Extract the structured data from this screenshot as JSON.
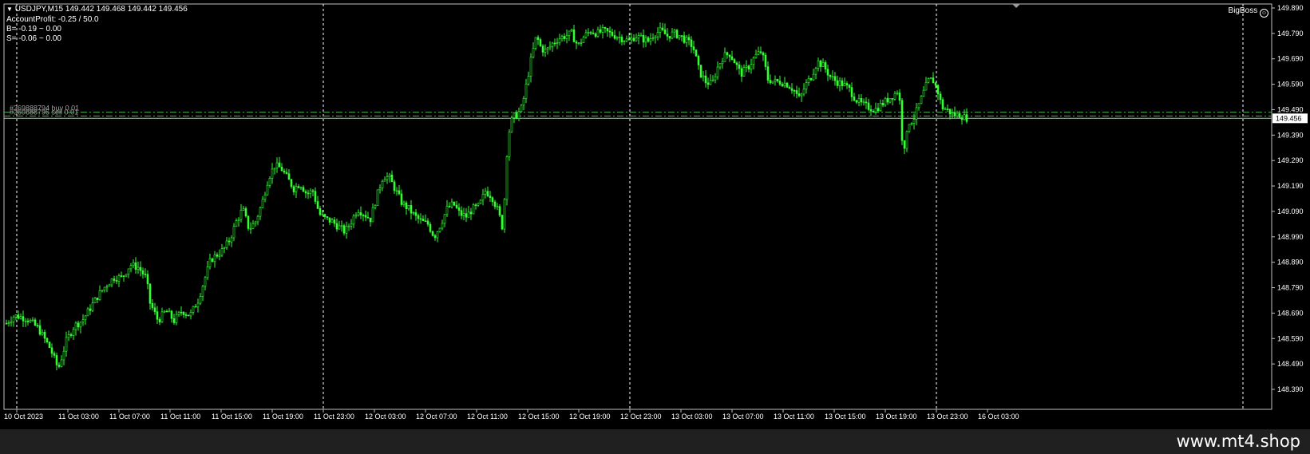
{
  "header": {
    "symbol_line": "USDJPY,M15  149.442 149.468 149.442 149.456",
    "account_profit": "AccountProfit:  -0.25 / 50.0",
    "b_line": "B= -0.19 ~ 0.00",
    "s_line": "S= -0.06 ~ 0.00",
    "brand": "BigBoss"
  },
  "footer": {
    "website": "www.mt4.shop"
  },
  "colors": {
    "background": "#000000",
    "candles": "#33ff33",
    "price_line": "#a8c8a8",
    "grid": "#ffffff"
  },
  "icons": {
    "collapse": "triangle-down-icon",
    "smiley": "smiley-icon"
  },
  "chart_data": {
    "type": "candlestick",
    "symbol": "USDJPY",
    "timeframe": "M15",
    "ohlc": {
      "open": 149.442,
      "high": 149.468,
      "low": 149.442,
      "close": 149.456
    },
    "ylim": [
      148.39,
      149.89
    ],
    "y_ticks": [
      "149.890",
      "149.790",
      "149.690",
      "149.590",
      "149.490",
      "149.390",
      "149.290",
      "149.190",
      "149.090",
      "148.990",
      "148.890",
      "148.790",
      "148.690",
      "148.590",
      "148.490",
      "148.390"
    ],
    "current_price": "149.456",
    "x_ticks": [
      "10 Oct 2023",
      "11 Oct 03:00",
      "11 Oct 07:00",
      "11 Oct 11:00",
      "11 Oct 15:00",
      "11 Oct 19:00",
      "11 Oct 23:00",
      "12 Oct 03:00",
      "12 Oct 07:00",
      "12 Oct 11:00",
      "12 Oct 15:00",
      "12 Oct 19:00",
      "12 Oct 23:00",
      "13 Oct 03:00",
      "13 Oct 07:00",
      "13 Oct 11:00",
      "13 Oct 15:00",
      "13 Oct 19:00",
      "13 Oct 23:00",
      "16 Oct 03:00"
    ],
    "orders": [
      {
        "label": "#369888794 buy 0.01",
        "price": 149.48
      },
      {
        "label": "#369888795 sell 0.01",
        "price": 149.465
      }
    ],
    "close_path": [
      [
        0,
        148.65
      ],
      [
        10,
        148.68
      ],
      [
        25,
        148.67
      ],
      [
        40,
        148.63
      ],
      [
        55,
        148.55
      ],
      [
        65,
        148.47
      ],
      [
        75,
        148.58
      ],
      [
        85,
        148.64
      ],
      [
        95,
        148.66
      ],
      [
        105,
        148.71
      ],
      [
        115,
        148.76
      ],
      [
        125,
        148.8
      ],
      [
        135,
        148.83
      ],
      [
        145,
        148.83
      ],
      [
        155,
        148.88
      ],
      [
        165,
        148.87
      ],
      [
        175,
        148.83
      ],
      [
        180,
        148.73
      ],
      [
        190,
        148.66
      ],
      [
        200,
        148.7
      ],
      [
        210,
        148.66
      ],
      [
        220,
        148.7
      ],
      [
        230,
        148.68
      ],
      [
        240,
        148.74
      ],
      [
        248,
        148.82
      ],
      [
        256,
        148.9
      ],
      [
        264,
        148.92
      ],
      [
        272,
        148.94
      ],
      [
        280,
        148.98
      ],
      [
        288,
        149.05
      ],
      [
        296,
        149.1
      ],
      [
        304,
        149.02
      ],
      [
        312,
        149.05
      ],
      [
        320,
        149.12
      ],
      [
        328,
        149.22
      ],
      [
        336,
        149.27
      ],
      [
        344,
        149.26
      ],
      [
        352,
        149.22
      ],
      [
        360,
        149.18
      ],
      [
        368,
        149.2
      ],
      [
        376,
        149.16
      ],
      [
        384,
        149.17
      ],
      [
        392,
        149.08
      ],
      [
        400,
        149.06
      ],
      [
        408,
        149.05
      ],
      [
        416,
        149.03
      ],
      [
        424,
        149.01
      ],
      [
        432,
        149.05
      ],
      [
        440,
        149.1
      ],
      [
        448,
        149.08
      ],
      [
        456,
        149.06
      ],
      [
        464,
        149.15
      ],
      [
        472,
        149.23
      ],
      [
        480,
        149.22
      ],
      [
        488,
        149.17
      ],
      [
        496,
        149.12
      ],
      [
        504,
        149.1
      ],
      [
        512,
        149.07
      ],
      [
        520,
        149.05
      ],
      [
        528,
        149.04
      ],
      [
        536,
        148.99
      ],
      [
        544,
        149.04
      ],
      [
        552,
        149.1
      ],
      [
        560,
        149.12
      ],
      [
        568,
        149.08
      ],
      [
        576,
        149.07
      ],
      [
        584,
        149.1
      ],
      [
        592,
        149.11
      ],
      [
        600,
        149.17
      ],
      [
        608,
        149.15
      ],
      [
        616,
        149.09
      ],
      [
        622,
        149.02
      ],
      [
        628,
        149.38
      ],
      [
        634,
        149.46
      ],
      [
        640,
        149.47
      ],
      [
        646,
        149.5
      ],
      [
        652,
        149.6
      ],
      [
        658,
        149.7
      ],
      [
        664,
        149.78
      ],
      [
        670,
        149.73
      ],
      [
        676,
        149.72
      ],
      [
        684,
        149.75
      ],
      [
        692,
        149.77
      ],
      [
        700,
        149.78
      ],
      [
        708,
        149.79
      ],
      [
        716,
        149.74
      ],
      [
        724,
        149.78
      ],
      [
        732,
        149.8
      ],
      [
        740,
        149.79
      ],
      [
        748,
        149.8
      ],
      [
        756,
        149.79
      ],
      [
        764,
        149.78
      ],
      [
        772,
        149.77
      ],
      [
        780,
        149.76
      ],
      [
        788,
        149.78
      ],
      [
        796,
        149.77
      ],
      [
        804,
        149.76
      ],
      [
        812,
        149.79
      ],
      [
        820,
        149.8
      ],
      [
        828,
        149.78
      ],
      [
        836,
        149.79
      ],
      [
        844,
        149.78
      ],
      [
        852,
        149.76
      ],
      [
        860,
        149.74
      ],
      [
        868,
        149.64
      ],
      [
        876,
        149.6
      ],
      [
        884,
        149.59
      ],
      [
        890,
        149.65
      ],
      [
        898,
        149.7
      ],
      [
        906,
        149.71
      ],
      [
        912,
        149.68
      ],
      [
        920,
        149.63
      ],
      [
        930,
        149.66
      ],
      [
        938,
        149.7
      ],
      [
        946,
        149.72
      ],
      [
        954,
        149.61
      ],
      [
        962,
        149.6
      ],
      [
        970,
        149.6
      ],
      [
        978,
        149.59
      ],
      [
        986,
        149.57
      ],
      [
        994,
        149.53
      ],
      [
        1000,
        149.58
      ],
      [
        1008,
        149.62
      ],
      [
        1016,
        149.68
      ],
      [
        1024,
        149.66
      ],
      [
        1032,
        149.62
      ],
      [
        1040,
        149.6
      ],
      [
        1048,
        149.59
      ],
      [
        1056,
        149.57
      ],
      [
        1064,
        149.53
      ],
      [
        1072,
        149.51
      ],
      [
        1080,
        149.5
      ],
      [
        1088,
        149.49
      ],
      [
        1096,
        149.51
      ],
      [
        1104,
        149.53
      ],
      [
        1112,
        149.55
      ],
      [
        1118,
        149.57
      ],
      [
        1122,
        149.38
      ],
      [
        1126,
        149.34
      ],
      [
        1130,
        149.44
      ],
      [
        1136,
        149.45
      ],
      [
        1142,
        149.5
      ],
      [
        1148,
        149.55
      ],
      [
        1154,
        149.6
      ],
      [
        1160,
        149.61
      ],
      [
        1166,
        149.57
      ],
      [
        1172,
        149.5
      ],
      [
        1178,
        149.49
      ],
      [
        1186,
        149.47
      ],
      [
        1194,
        149.47
      ],
      [
        1200,
        149.46
      ],
      [
        1206,
        149.456
      ]
    ]
  }
}
